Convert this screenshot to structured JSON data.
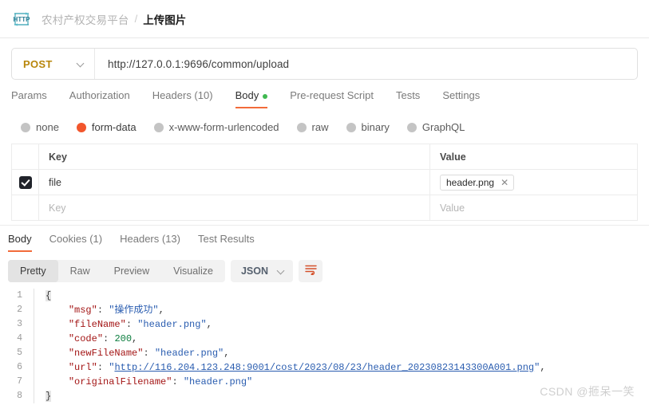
{
  "breadcrumb": {
    "icon": "http-protocol-icon",
    "parent": "农村产权交易平台",
    "separator": "/",
    "current": "上传图片"
  },
  "request": {
    "method": "POST",
    "url": "http://127.0.0.1:9696/common/upload",
    "tabs": [
      {
        "label": "Params",
        "active": false
      },
      {
        "label": "Authorization",
        "active": false
      },
      {
        "label": "Headers (10)",
        "active": false
      },
      {
        "label": "Body",
        "active": true,
        "dot": true
      },
      {
        "label": "Pre-request Script",
        "active": false
      },
      {
        "label": "Tests",
        "active": false
      },
      {
        "label": "Settings",
        "active": false
      }
    ],
    "body_types": [
      {
        "label": "none",
        "selected": false
      },
      {
        "label": "form-data",
        "selected": true
      },
      {
        "label": "x-www-form-urlencoded",
        "selected": false
      },
      {
        "label": "raw",
        "selected": false
      },
      {
        "label": "binary",
        "selected": false
      },
      {
        "label": "GraphQL",
        "selected": false
      }
    ],
    "table": {
      "headers": {
        "key": "Key",
        "value": "Value"
      },
      "rows": [
        {
          "checked": true,
          "key": "file",
          "value": "header.png",
          "is_file": true,
          "remove_label": "✕"
        }
      ],
      "placeholder_row": {
        "key": "Key",
        "value": "Value"
      }
    }
  },
  "response": {
    "tabs": [
      {
        "label": "Body",
        "active": true
      },
      {
        "label": "Cookies (1)",
        "active": false
      },
      {
        "label": "Headers (13)",
        "active": false
      },
      {
        "label": "Test Results",
        "active": false
      }
    ],
    "view_modes": [
      {
        "label": "Pretty",
        "active": true
      },
      {
        "label": "Raw",
        "active": false
      },
      {
        "label": "Preview",
        "active": false
      },
      {
        "label": "Visualize",
        "active": false
      }
    ],
    "format": "JSON",
    "wrap_icon": "wrap-lines-icon",
    "json": {
      "line_numbers": [
        1,
        2,
        3,
        4,
        5,
        6,
        7,
        8
      ],
      "fields": {
        "msg": "操作成功",
        "fileName": "header.png",
        "code": 200,
        "newFileName": "header.png",
        "url": "http://116.204.123.248:9001/cost/2023/08/23/header_20230823143300A001.png",
        "originalFilename": "header.png"
      },
      "keys": {
        "msg": "\"msg\"",
        "fileName": "\"fileName\"",
        "code": "\"code\"",
        "newFileName": "\"newFileName\"",
        "url": "\"url\"",
        "originalFilename": "\"originalFilename\""
      },
      "values": {
        "msg": "\"操作成功\"",
        "fileName": "\"header.png\"",
        "code": "200",
        "newFileName": "\"header.png\"",
        "url_open": "\"",
        "url_text": "http://116.204.123.248:9001/cost/2023/08/23/header_20230823143300A001.png",
        "url_close": "\"",
        "originalFilename": "\"header.png\""
      },
      "open_brace": "{",
      "close_brace": "}",
      "colon": ": ",
      "comma": ","
    }
  },
  "watermark": "CSDN @㧜呆一笑",
  "colors": {
    "accent": "#f26b3a",
    "method": "#b8860b",
    "green": "#4aa96c",
    "json_key": "#a31515",
    "json_string": "#2a5db0",
    "json_number": "#0b7d3e"
  }
}
